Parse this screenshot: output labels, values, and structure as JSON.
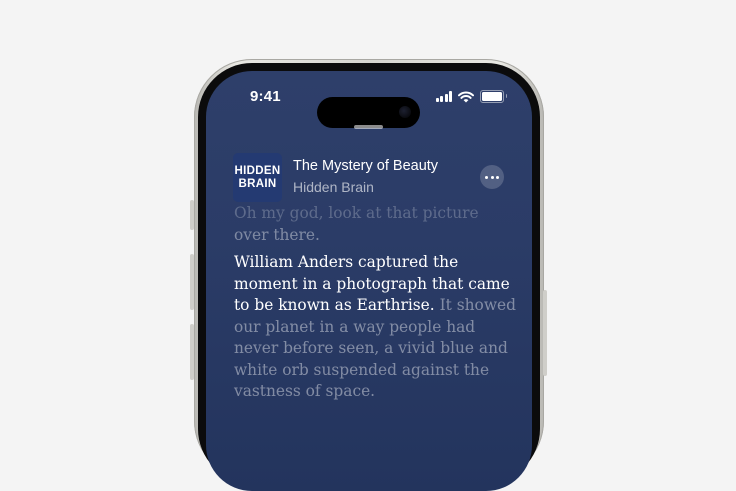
{
  "status_bar": {
    "time": "9:41"
  },
  "now_playing": {
    "artwork_lines": [
      "HIDDEN",
      "BRAIN"
    ],
    "episode_title": "The Mystery of Beauty",
    "show_name": "Hidden Brain"
  },
  "transcript": {
    "previous_line_1": "Oh my god, look at that picture",
    "previous_line_2": "over there.",
    "active_text": "William Anders captured the moment in a photograph that came to be known as Earthrise.",
    "upcoming_text": " It showed our planet in a way people had never before seen, a vivid blue and white orb suspended against the vastness of space."
  },
  "colors": {
    "screen_background": "#2b3c67",
    "artwork_background": "#243a72",
    "active_text": "#ffffff"
  },
  "icons": {
    "signal": "cellular-signal-icon",
    "wifi": "wifi-icon",
    "battery": "battery-icon",
    "more": "ellipsis-icon"
  }
}
